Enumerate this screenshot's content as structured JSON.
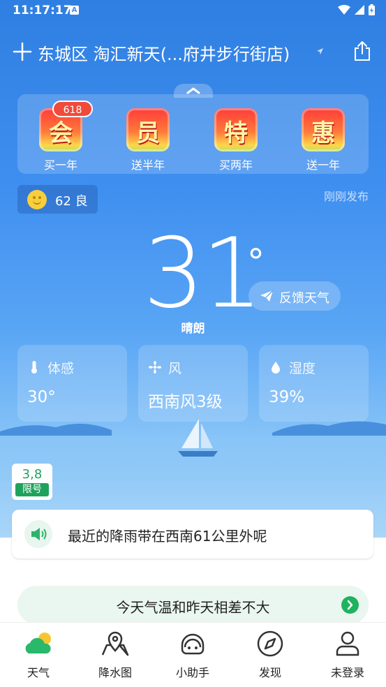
{
  "status_bar": {
    "time": "11:17:17",
    "app_indicator": "A"
  },
  "header": {
    "location": "东城区 淘汇新天(...府井步行街店)"
  },
  "promo": {
    "badge": "618",
    "items": [
      {
        "char": "会",
        "caption": "买一年"
      },
      {
        "char": "员",
        "caption": "送半年"
      },
      {
        "char": "特",
        "caption": "买两年"
      },
      {
        "char": "惠",
        "caption": "送一年"
      }
    ]
  },
  "aqi": {
    "text": "62 良"
  },
  "published": "刚刚发布",
  "weather": {
    "temperature": "31",
    "degree_symbol": "°",
    "condition": "晴朗",
    "feedback_label": "反馈天气"
  },
  "details": [
    {
      "title": "体感",
      "value": "30°",
      "icon": "thermometer-icon"
    },
    {
      "title": "风",
      "value": "西南风3级",
      "icon": "fan-icon"
    },
    {
      "title": "湿度",
      "value": "39%",
      "icon": "droplet-icon"
    }
  ],
  "plate": {
    "numbers": "3,8",
    "label": "限号"
  },
  "notice": {
    "text": "最近的降雨带在西南61公里外呢"
  },
  "compare": {
    "text": "今天气温和昨天相差不大"
  },
  "tabs": [
    {
      "label": "天气",
      "icon": "weather-icon"
    },
    {
      "label": "降水图",
      "icon": "map-icon"
    },
    {
      "label": "小助手",
      "icon": "assistant-icon"
    },
    {
      "label": "发现",
      "icon": "compass-icon"
    },
    {
      "label": "未登录",
      "icon": "user-icon"
    }
  ]
}
